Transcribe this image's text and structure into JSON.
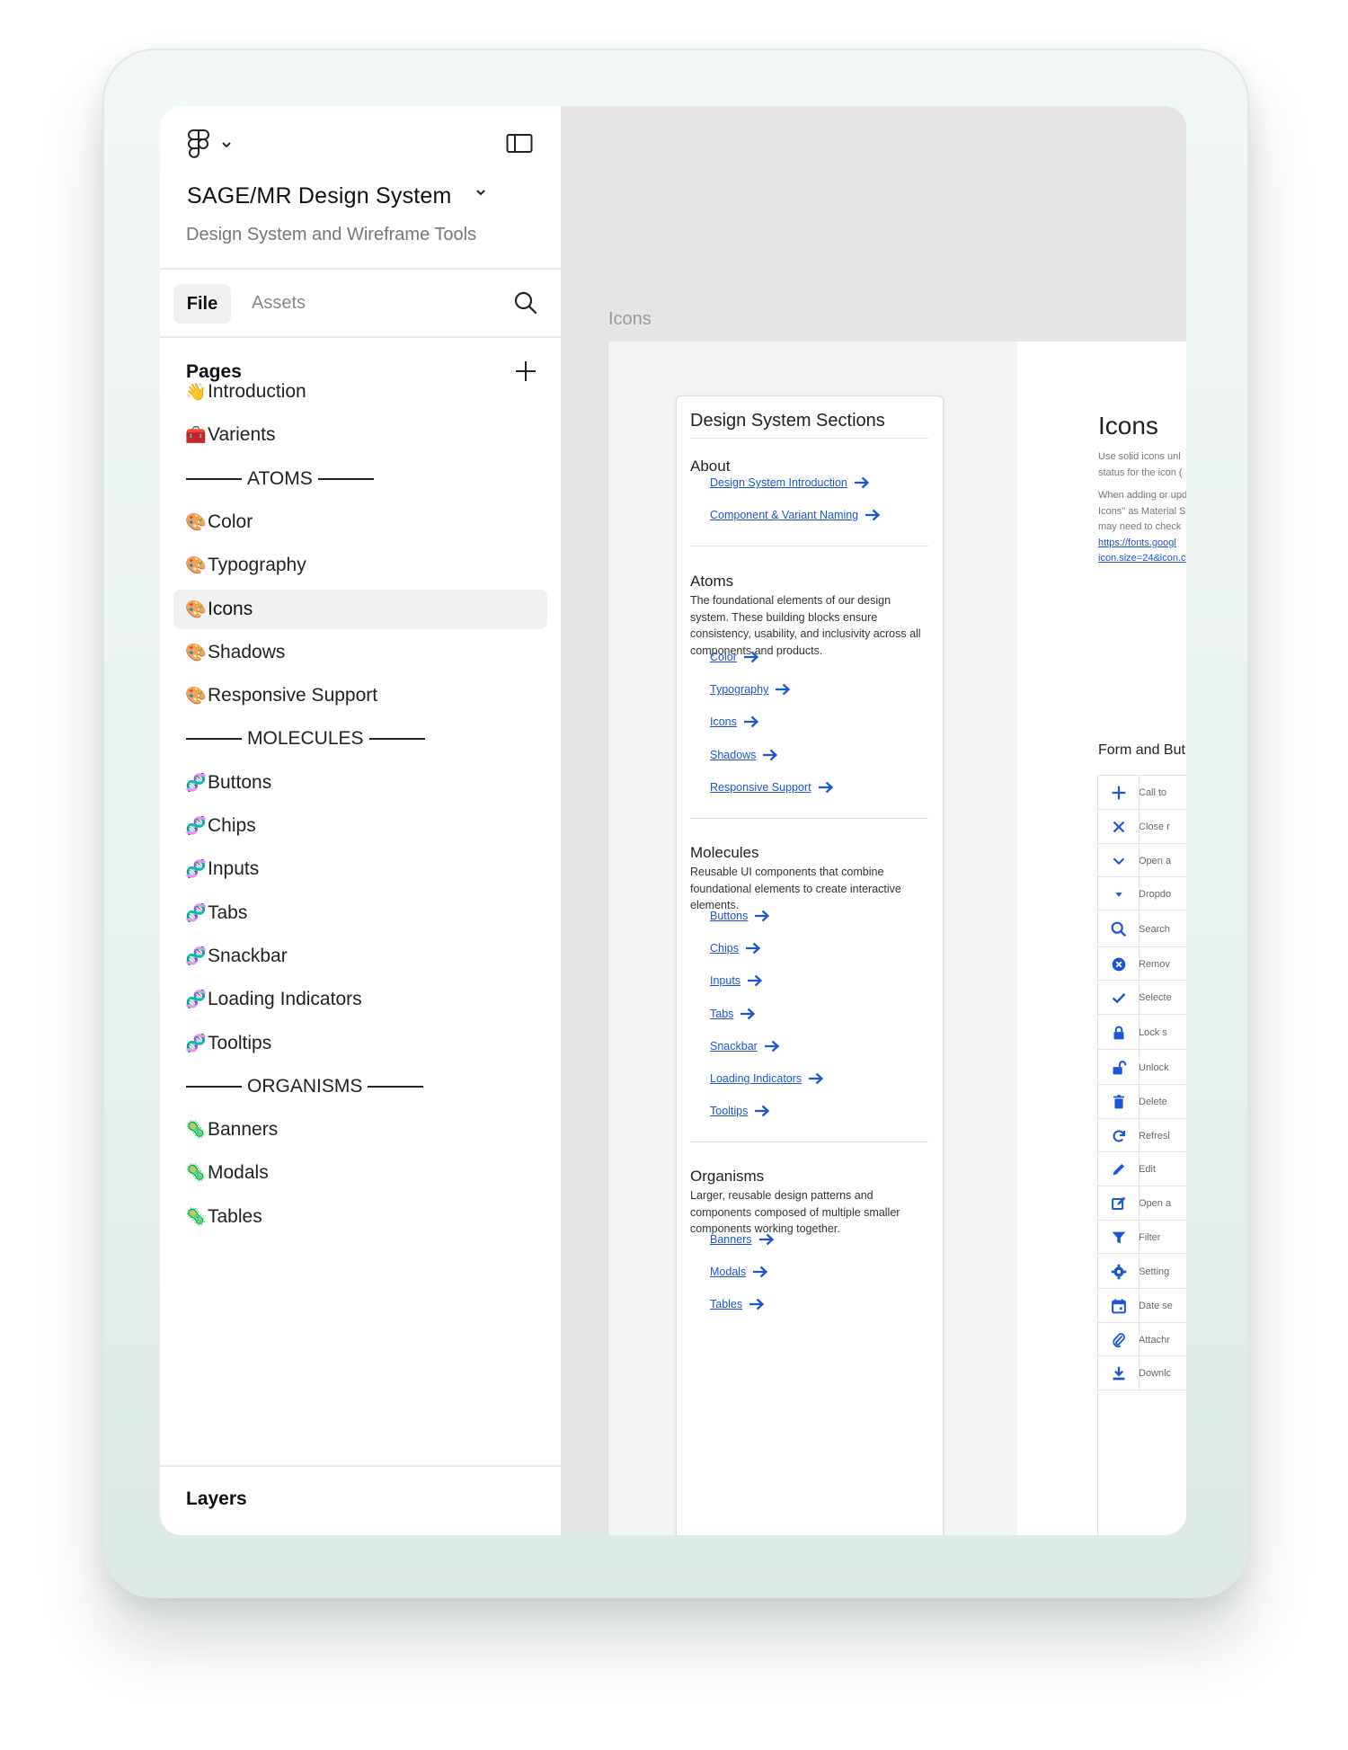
{
  "header": {
    "project_title": "SAGE/MR Design System",
    "project_subtitle": "Design System and Wireframe Tools"
  },
  "tabs": {
    "file": "File",
    "assets": "Assets"
  },
  "pages": {
    "heading": "Pages",
    "items": [
      {
        "emoji": "👋",
        "label": "Introduction"
      },
      {
        "emoji": "🧰",
        "label": "Varients"
      },
      {
        "separator": true,
        "label": "ATOMS"
      },
      {
        "emoji": "🎨",
        "label": "Color"
      },
      {
        "emoji": "🎨",
        "label": "Typography"
      },
      {
        "emoji": "🎨",
        "label": "Icons",
        "selected": true
      },
      {
        "emoji": "🎨",
        "label": "Shadows"
      },
      {
        "emoji": "🎨",
        "label": "Responsive Support"
      },
      {
        "separator": true,
        "label": "MOLECULES"
      },
      {
        "emoji": "🧬",
        "label": "Buttons"
      },
      {
        "emoji": "🧬",
        "label": "Chips"
      },
      {
        "emoji": "🧬",
        "label": "Inputs"
      },
      {
        "emoji": "🧬",
        "label": "Tabs"
      },
      {
        "emoji": "🧬",
        "label": "Snackbar"
      },
      {
        "emoji": "🧬",
        "label": "Loading Indicators"
      },
      {
        "emoji": "🧬",
        "label": "Tooltips"
      },
      {
        "separator": true,
        "label": "ORGANISMS"
      },
      {
        "emoji": "🦠",
        "label": "Banners"
      },
      {
        "emoji": "🦠",
        "label": "Modals"
      },
      {
        "emoji": "🦠",
        "label": "Tables"
      }
    ]
  },
  "layers": {
    "heading": "Layers"
  },
  "canvas": {
    "frame_label": "Icons",
    "nav_card": {
      "title": "Design System Sections",
      "about": {
        "heading": "About",
        "links": [
          "Design System Introduction",
          "Component & Variant Naming"
        ]
      },
      "atoms": {
        "heading": "Atoms",
        "description": "The foundational elements of our design system. These building blocks ensure consistency, usability, and inclusivity across all components and products.",
        "links": [
          "Color",
          "Typography",
          "Icons",
          "Shadows",
          "Responsive Support"
        ]
      },
      "molecules": {
        "heading": "Molecules",
        "description": "Reusable UI components that combine foundational elements to create interactive elements.",
        "links": [
          "Buttons",
          "Chips",
          "Inputs",
          "Tabs",
          "Snackbar",
          "Loading Indicators",
          "Tooltips"
        ]
      },
      "organisms": {
        "heading": "Organisms",
        "description": "Larger, reusable design patterns and components composed of multiple smaller components working together.",
        "links": [
          "Banners",
          "Modals",
          "Tables"
        ]
      }
    },
    "doc": {
      "title": "Icons",
      "para1_lines": [
        "Use solid icons unl",
        "status for the icon ("
      ],
      "para2_lines": [
        "When adding or upd",
        "Icons\" as Material S",
        "may need to check"
      ],
      "link_lines": [
        "https://fonts.googl",
        "icon.size=24&icon.c"
      ],
      "section_heading": "Form and But",
      "icon_rows": [
        {
          "icon": "plus-icon",
          "label": "Call to"
        },
        {
          "icon": "close-icon",
          "label": "Close r"
        },
        {
          "icon": "chevron-down-icon",
          "label": "Open a"
        },
        {
          "icon": "dropdown-arrow-icon",
          "label": "Dropdo"
        },
        {
          "icon": "search-icon",
          "label": "Search"
        },
        {
          "icon": "cancel-circle-icon",
          "label": "Remov"
        },
        {
          "icon": "check-icon",
          "label": "Selecte"
        },
        {
          "icon": "lock-icon",
          "label": "Lock s"
        },
        {
          "icon": "unlock-icon",
          "label": "Unlock"
        },
        {
          "icon": "trash-icon",
          "label": "Delete"
        },
        {
          "icon": "refresh-icon",
          "label": "Refresl"
        },
        {
          "icon": "pencil-icon",
          "label": "Edit"
        },
        {
          "icon": "edit-square-icon",
          "label": "Open a"
        },
        {
          "icon": "filter-icon",
          "label": "Filter"
        },
        {
          "icon": "settings-icon",
          "label": "Setting"
        },
        {
          "icon": "calendar-icon",
          "label": "Date se"
        },
        {
          "icon": "attach-icon",
          "label": "Attachr"
        },
        {
          "icon": "download-icon",
          "label": "Downlc"
        }
      ]
    }
  },
  "colors": {
    "link": "#1a56d6",
    "icon": "#1a56d6",
    "selected_page_bg": "#f1f1f1"
  }
}
